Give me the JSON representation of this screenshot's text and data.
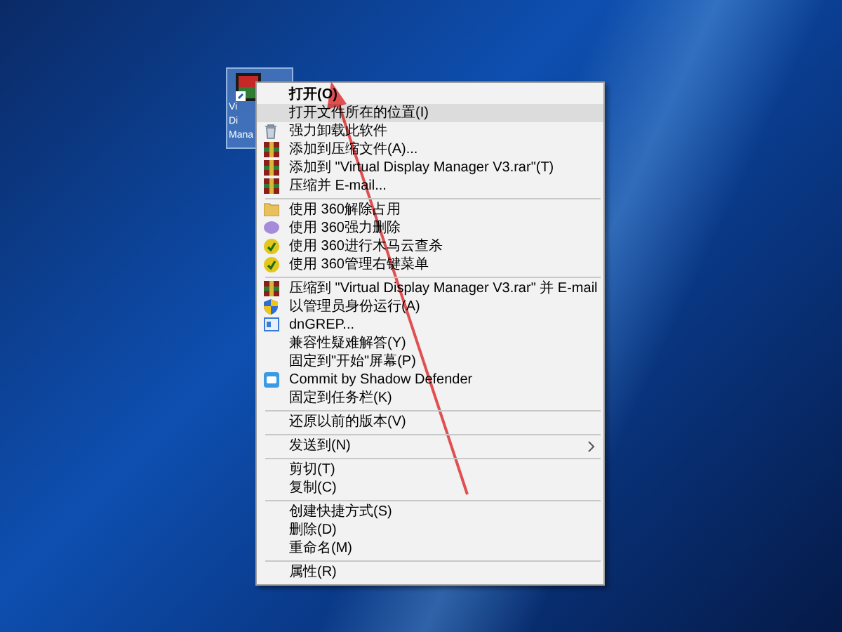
{
  "desktop_icon": {
    "label_lines": [
      "Vi",
      "Di",
      "Mana"
    ],
    "selected": true
  },
  "context_menu": {
    "items": [
      {
        "kind": "plain",
        "label": "打开(O)",
        "default": true,
        "selected": false
      },
      {
        "kind": "plain",
        "label": "打开文件所在的位置(I)",
        "selected": true
      },
      {
        "kind": "trash",
        "label": "强力卸载此软件",
        "selected": false
      },
      {
        "kind": "archive",
        "label": "添加到压缩文件(A)...",
        "selected": false
      },
      {
        "kind": "archive",
        "label": "添加到 \"Virtual Display Manager V3.rar\"(T)",
        "selected": false
      },
      {
        "kind": "archive",
        "label": "压缩并 E-mail...",
        "selected": false
      },
      {
        "kind": "separator"
      },
      {
        "kind": "folder",
        "label": "使用 360解除占用",
        "selected": false
      },
      {
        "kind": "eraser",
        "label": "使用 360强力删除",
        "selected": false
      },
      {
        "kind": "check",
        "label": "使用 360进行木马云查杀",
        "selected": false
      },
      {
        "kind": "check",
        "label": "使用 360管理右键菜单",
        "selected": false
      },
      {
        "kind": "separator"
      },
      {
        "kind": "archive",
        "label": "压缩到 \"Virtual Display Manager V3.rar\" 并 E-mail",
        "selected": false
      },
      {
        "kind": "shield",
        "label": "以管理员身份运行(A)",
        "selected": false
      },
      {
        "kind": "window",
        "label": "dnGREP...",
        "selected": false
      },
      {
        "kind": "plain",
        "label": "兼容性疑难解答(Y)",
        "selected": false
      },
      {
        "kind": "plain",
        "label": "固定到\"开始\"屏幕(P)",
        "selected": false
      },
      {
        "kind": "defender",
        "label": "Commit by Shadow Defender",
        "selected": false
      },
      {
        "kind": "plain",
        "label": "固定到任务栏(K)",
        "selected": false
      },
      {
        "kind": "separator"
      },
      {
        "kind": "plain",
        "label": "还原以前的版本(V)",
        "selected": false
      },
      {
        "kind": "separator"
      },
      {
        "kind": "plain",
        "label": "发送到(N)",
        "submenu": true,
        "selected": false
      },
      {
        "kind": "separator"
      },
      {
        "kind": "plain",
        "label": "剪切(T)",
        "selected": false
      },
      {
        "kind": "plain",
        "label": "复制(C)",
        "selected": false
      },
      {
        "kind": "separator"
      },
      {
        "kind": "plain",
        "label": "创建快捷方式(S)",
        "selected": false
      },
      {
        "kind": "plain",
        "label": "删除(D)",
        "selected": false
      },
      {
        "kind": "plain",
        "label": "重命名(M)",
        "selected": false
      },
      {
        "kind": "separator"
      },
      {
        "kind": "plain",
        "label": "属性(R)",
        "selected": false
      }
    ]
  }
}
